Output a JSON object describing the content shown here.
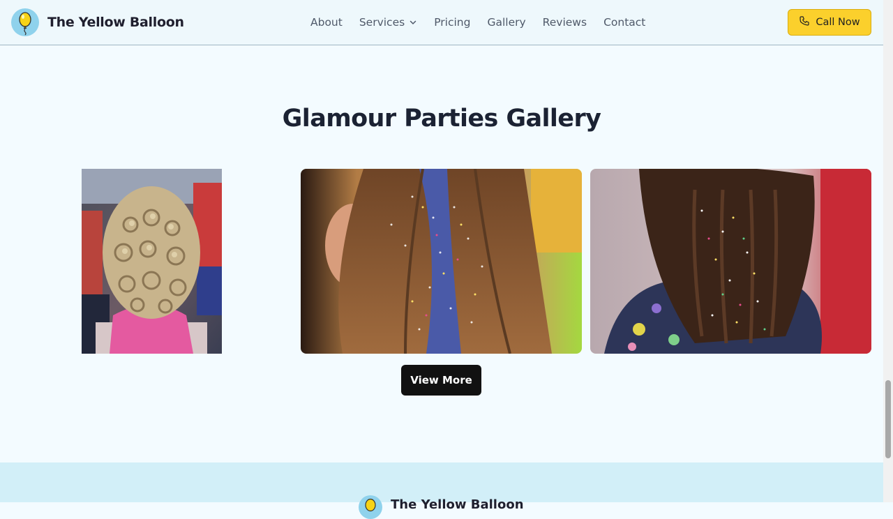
{
  "header": {
    "brand_name": "The Yellow Balloon",
    "logo_icon": "balloon-icon",
    "nav": [
      {
        "label": "About"
      },
      {
        "label": "Services",
        "has_dropdown": true
      },
      {
        "label": "Pricing"
      },
      {
        "label": "Gallery"
      },
      {
        "label": "Reviews"
      },
      {
        "label": "Contact"
      }
    ],
    "call_button": {
      "label": "Call Now",
      "icon": "phone-icon"
    }
  },
  "gallery": {
    "title": "Glamour Parties Gallery",
    "photos": [
      {
        "subject": "curly-updo-photo"
      },
      {
        "subject": "blue-glitter-strand-photo"
      },
      {
        "subject": "glitter-braids-photo"
      }
    ],
    "view_more_label": "View More"
  },
  "footer": {
    "brand_name": "The Yellow Balloon"
  },
  "colors": {
    "page_bg": "#f3fbff",
    "header_bg": "#eef8fc",
    "accent_yellow": "#fbd02c",
    "footer_bg": "#d2eff8",
    "button_dark": "#111111"
  }
}
